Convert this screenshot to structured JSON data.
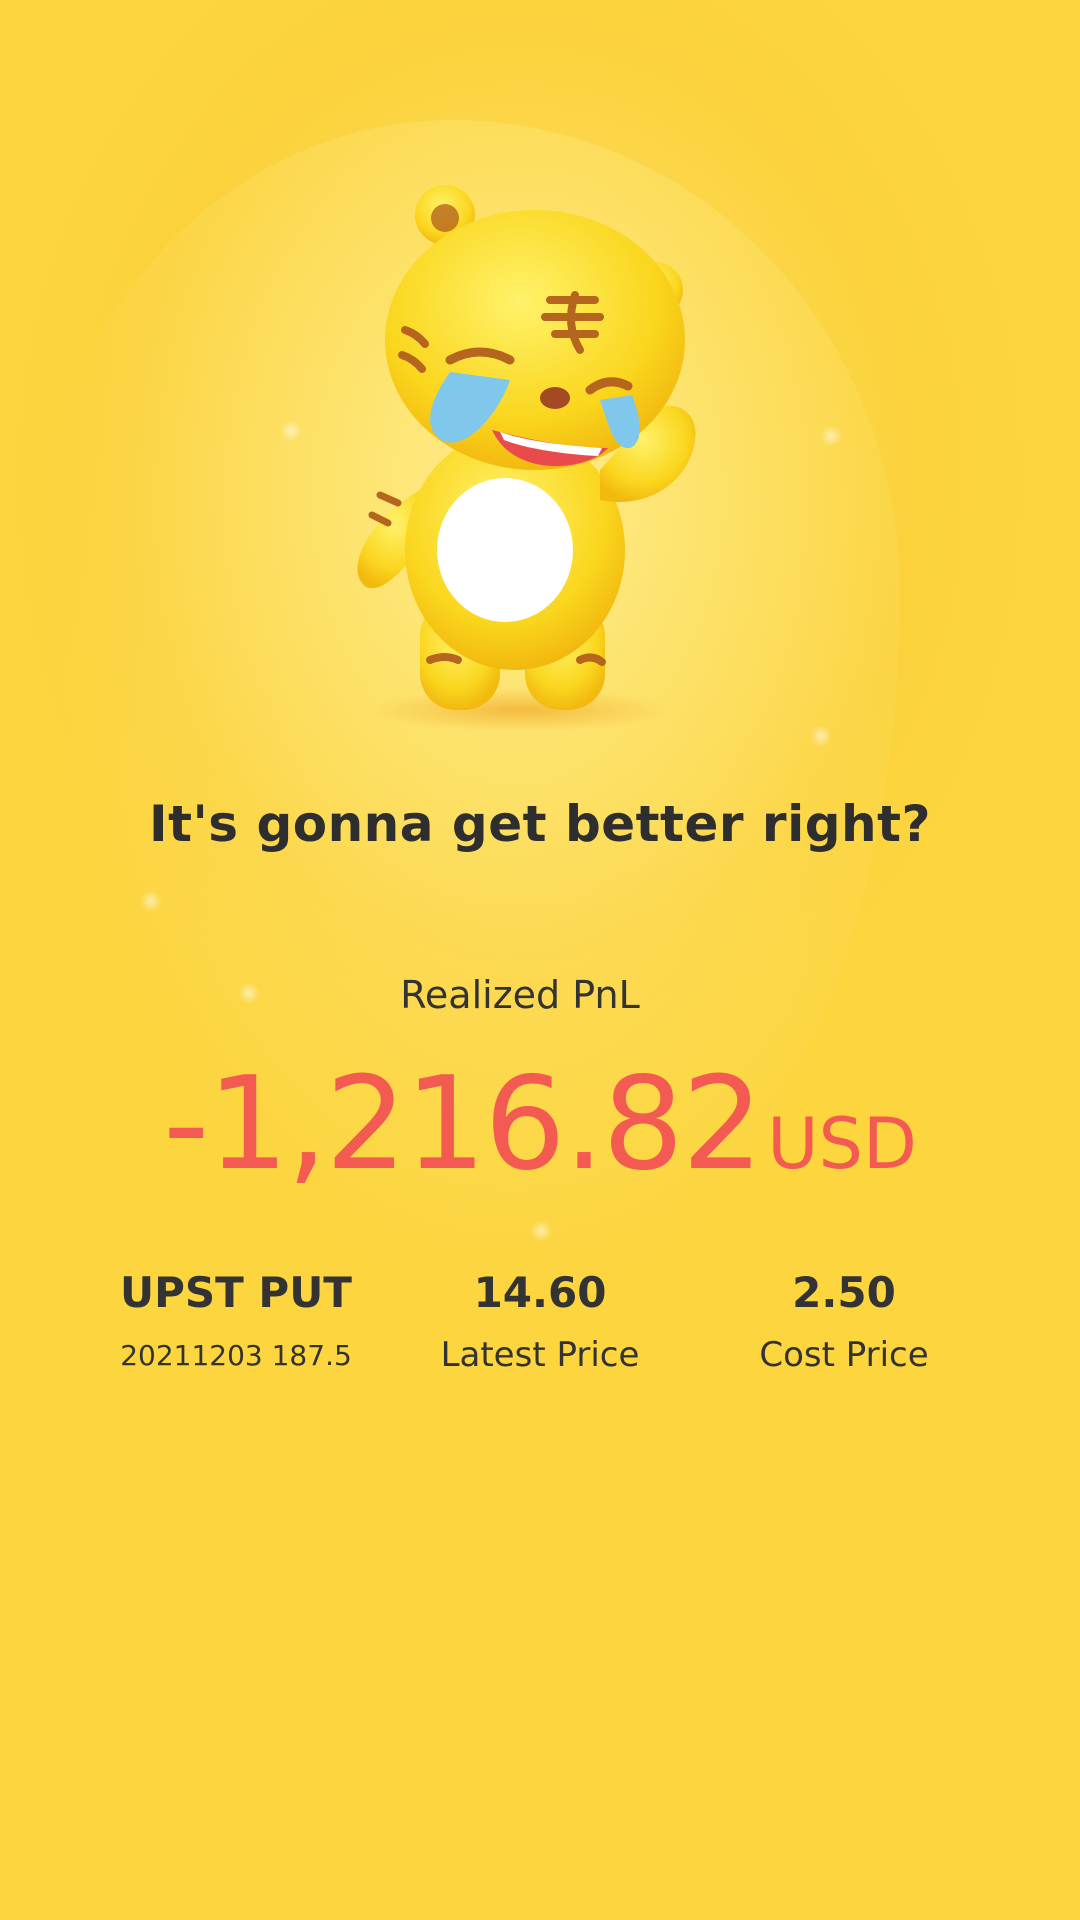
{
  "headline": "It's gonna get better right?",
  "pnl": {
    "label": "Realized PnL",
    "value": "-1,216.82",
    "currency": "USD",
    "color": "#f35a52"
  },
  "stats": [
    {
      "top": "UPST PUT",
      "bottom": "20211203 187.5"
    },
    {
      "top": "14.60",
      "bottom": "Latest Price"
    },
    {
      "top": "2.50",
      "bottom": "Cost Price"
    }
  ],
  "mascot": {
    "icon": "crying-tiger-mascot"
  },
  "colors": {
    "background": "#fcd53f",
    "text": "#2e2e2e"
  }
}
